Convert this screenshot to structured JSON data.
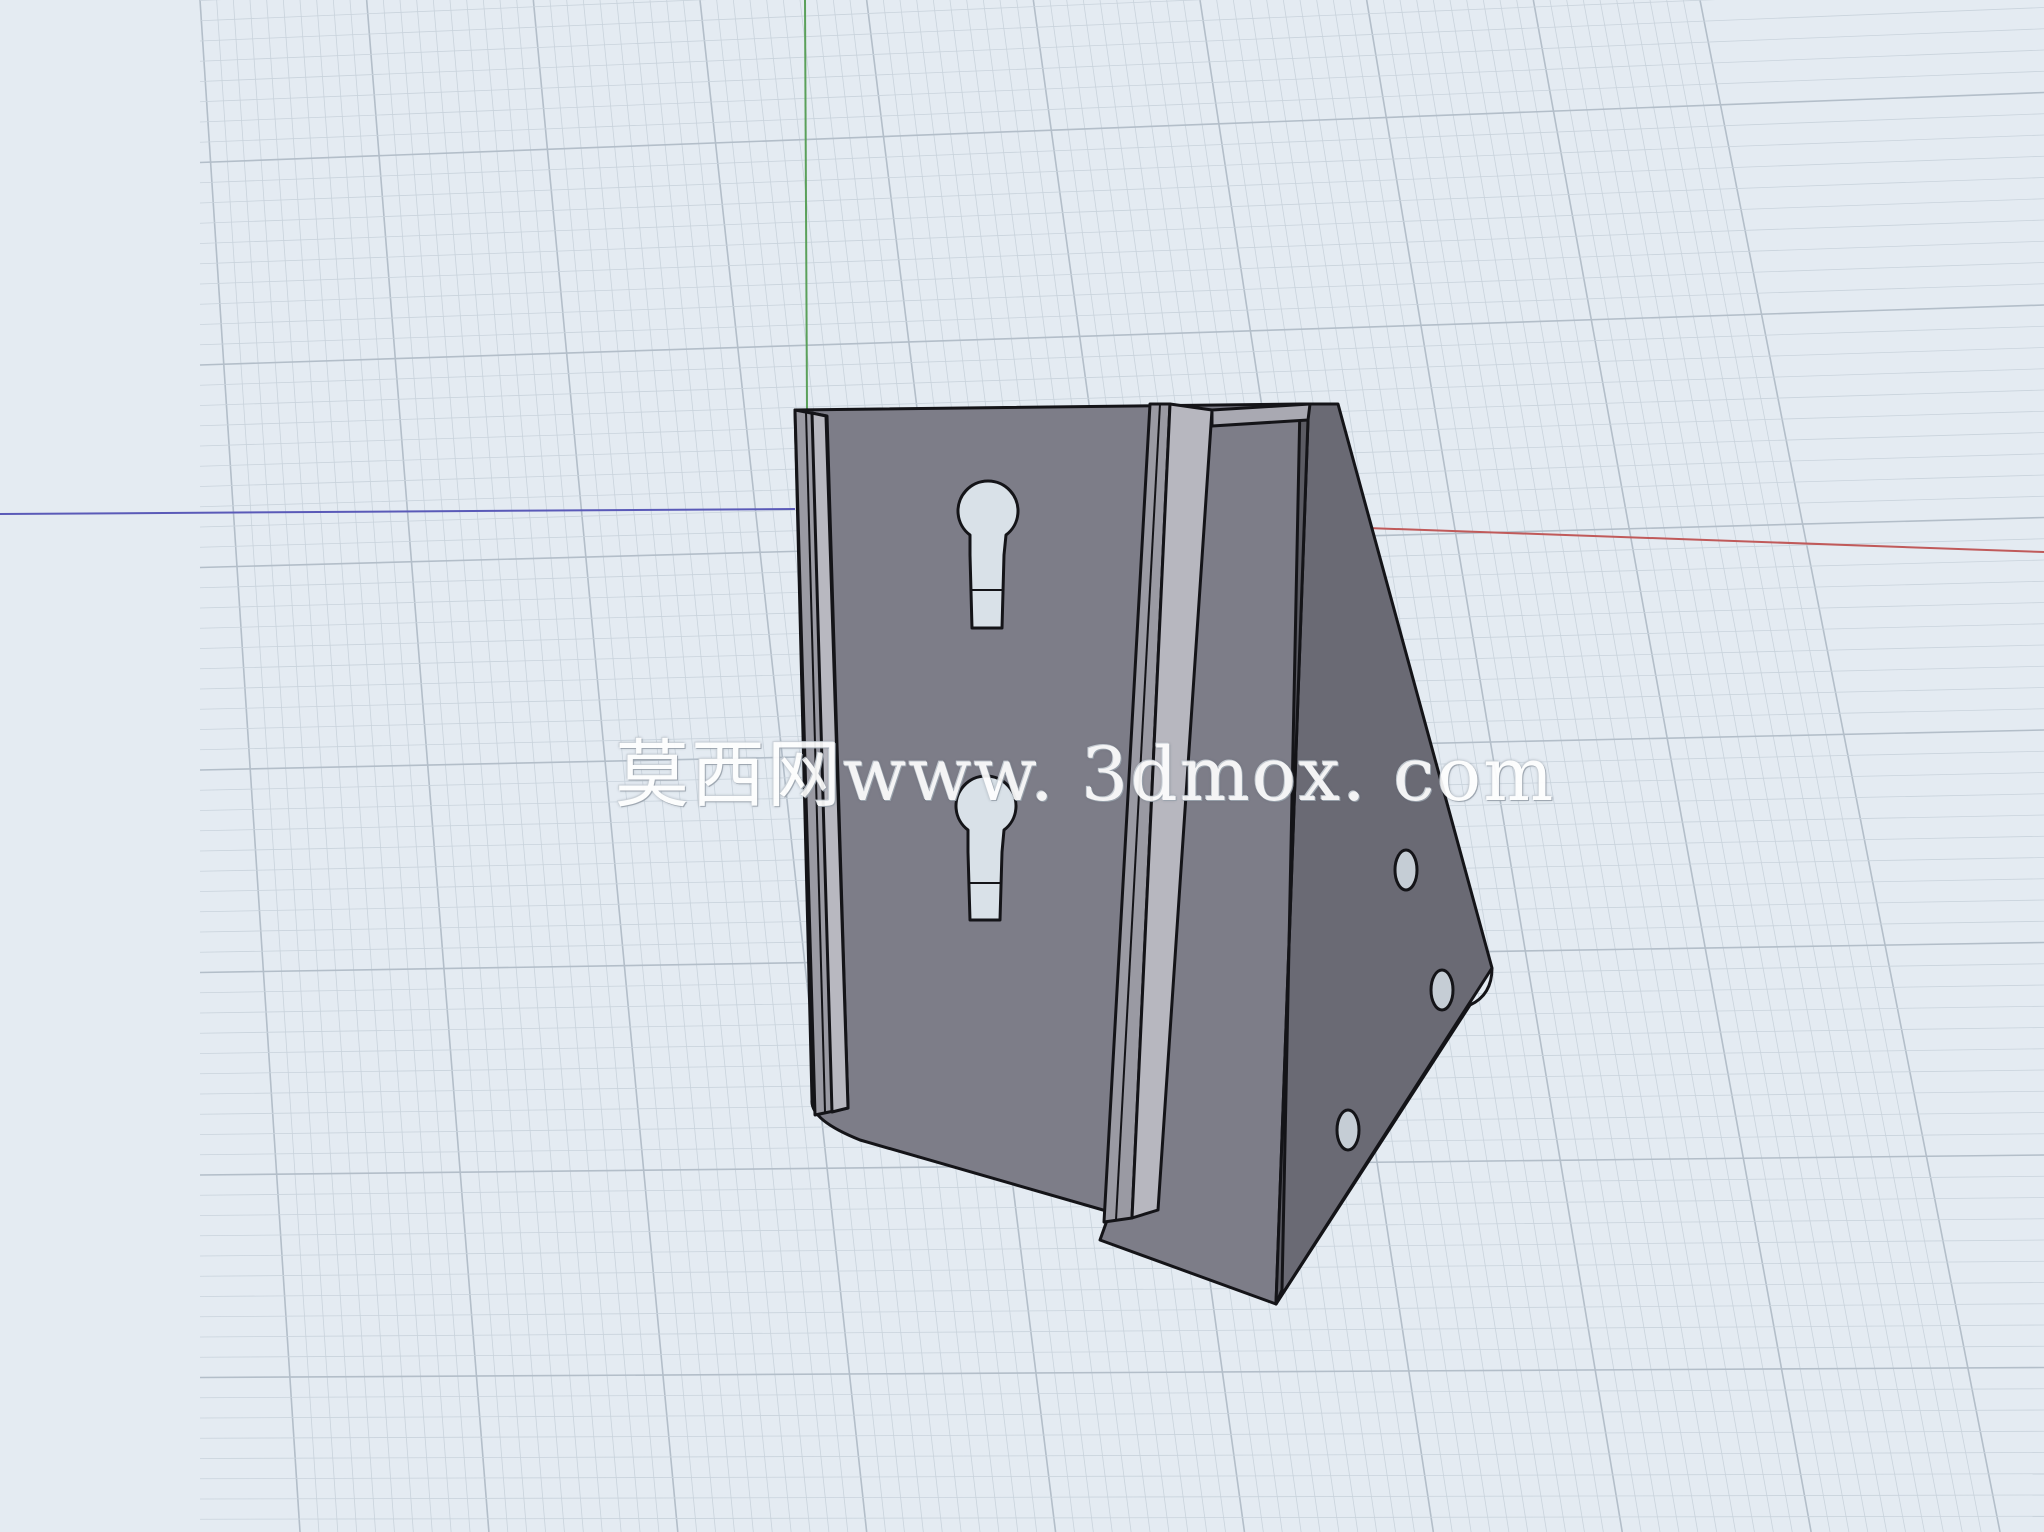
{
  "watermark": {
    "text": "莫西网www. 3dmox. com"
  },
  "colors": {
    "background": "#e4ebf2",
    "grid_minor": "#c9d3dc",
    "grid_major": "#b3bec9",
    "axis_x": "#c05a5a",
    "axis_y": "#5aa05a",
    "axis_z": "#5a5ab8",
    "part_face": "#7c7c86",
    "part_edge": "#141418"
  },
  "icons": {
    "axes": "axis-lines-icon",
    "model": "bracket-model-icon"
  }
}
